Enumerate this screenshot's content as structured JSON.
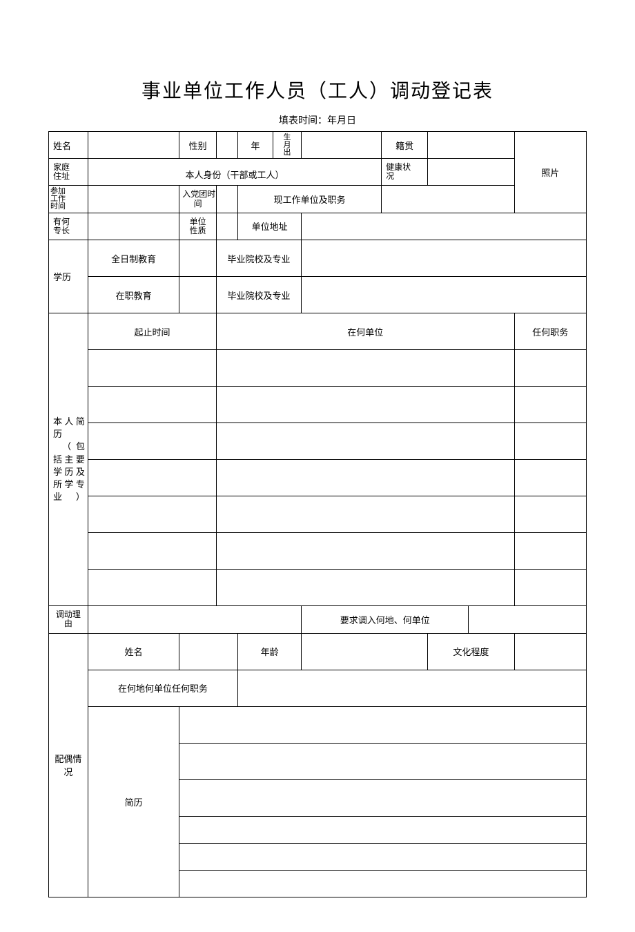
{
  "title": "事业单位工作人员（工人）调动登记表",
  "subtitle": "填表时间：年月日",
  "labels": {
    "name": "姓名",
    "gender": "性别",
    "birth_year": "年",
    "birth_month_out": "生\n月\n出",
    "native_place": "籍贯",
    "photo": "照片",
    "home_address": "家庭\n住址",
    "identity_header": "本人身份（干部或工人）",
    "health": "健康状\n况",
    "join_work": "参加\n工作\n时间",
    "party_time": "入党团时\n间",
    "current_unit": "现工作单位及职务",
    "speciality": "有何\n专长",
    "unit_nature": "单位\n性质",
    "unit_address": "单位地址",
    "education": "学历",
    "fulltime": "全日制教育",
    "onjob": "在职教育",
    "grad_school": "毕业院校及专业",
    "resume_label": "本人简\n历\n　（包\n括主要\n学历及\n所学专\n业）",
    "period": "起止时间",
    "at_unit": "在何单位",
    "any_position": "任何职务",
    "transfer_reason": "调动理\n由",
    "request_unit": "要求调入何地、何单位",
    "spouse_label": "配偶情\n况",
    "spouse_age": "年龄",
    "culture_level": "文化程度",
    "spouse_unit": "在何地何单位任何职务",
    "spouse_resume": "简历"
  }
}
